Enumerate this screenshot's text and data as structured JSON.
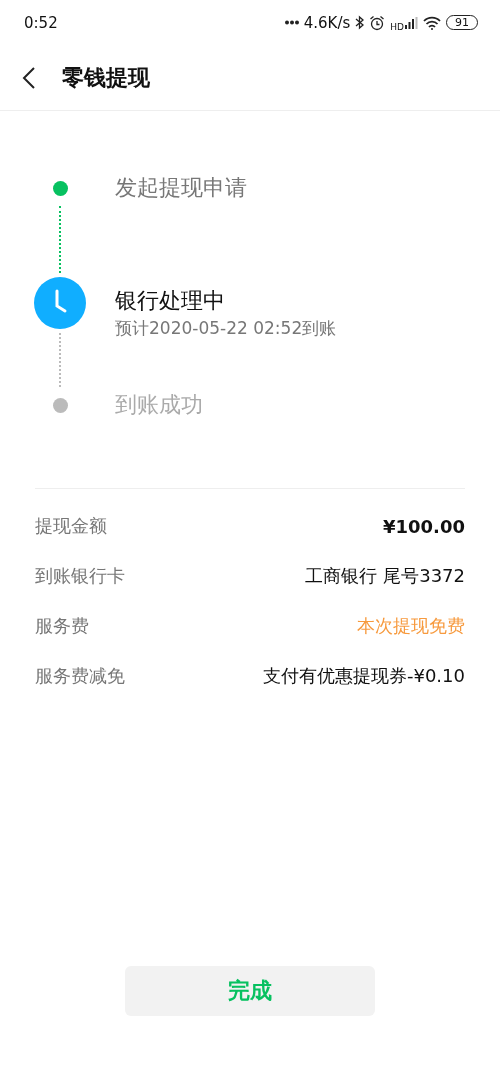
{
  "status_bar": {
    "time": "0:52",
    "network_speed": "4.6K/s",
    "signal_label": "HD",
    "battery": "91"
  },
  "header": {
    "title": "零钱提现"
  },
  "steps": [
    {
      "title": "发起提现申请",
      "kind": "done"
    },
    {
      "title": "银行处理中",
      "subtitle": "预计2020-05-22 02:52到账",
      "kind": "current"
    },
    {
      "title": "到账成功",
      "kind": "pending"
    }
  ],
  "details": [
    {
      "label": "提现金额",
      "value": "¥100.00",
      "kind": "strong"
    },
    {
      "label": "到账银行卡",
      "value": "工商银行 尾号3372",
      "kind": "plain"
    },
    {
      "label": "服务费",
      "value": "本次提现免费",
      "kind": "accent"
    },
    {
      "label": "服务费减免",
      "value": "支付有优惠提现券-¥0.10",
      "kind": "plain"
    }
  ],
  "button": {
    "label": "完成"
  }
}
